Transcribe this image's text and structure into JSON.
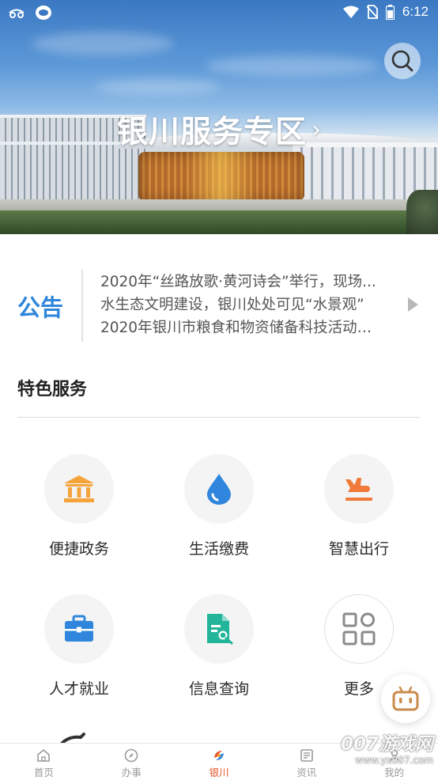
{
  "status_bar": {
    "time": "6:12",
    "left_icons": [
      "incognito-icon",
      "app-bubble-icon"
    ],
    "right_icons": [
      "wifi-icon",
      "no-sim-icon",
      "battery-icon"
    ]
  },
  "hero": {
    "title": "银川服务专区",
    "arrow": "›"
  },
  "notice": {
    "label": "公告",
    "items": [
      "2020年“丝路放歌·黄河诗会”举行，现场...",
      "水生态文明建设，银川处处可见“水景观”",
      "2020年银川市粮食和物资储备科技活动周..."
    ]
  },
  "section": {
    "title": "特色服务"
  },
  "services": [
    {
      "label": "便捷政务",
      "icon": "bank-icon",
      "color": "#f5a33b"
    },
    {
      "label": "生活缴费",
      "icon": "water-drop-icon",
      "color": "#2f86dc"
    },
    {
      "label": "智慧出行",
      "icon": "airplane-icon",
      "color": "#f07a3a"
    },
    {
      "label": "人才就业",
      "icon": "briefcase-icon",
      "color": "#2f86dc"
    },
    {
      "label": "信息查询",
      "icon": "document-search-icon",
      "color": "#23b59a"
    },
    {
      "label": "更多",
      "icon": "grid-icon",
      "color": "#8a8a8a"
    }
  ],
  "bottom_nav": [
    {
      "label": "首页",
      "icon": "home-icon",
      "active": false
    },
    {
      "label": "办事",
      "icon": "compass-icon",
      "active": false
    },
    {
      "label": "银川",
      "icon": "yinchuan-logo-icon",
      "active": true
    },
    {
      "label": "资讯",
      "icon": "news-icon",
      "active": false
    },
    {
      "label": "我的",
      "icon": "profile-icon",
      "active": false
    }
  ],
  "watermark": {
    "main": "007游戏网",
    "url": "www.yx007.com"
  },
  "colors": {
    "accent": "#2f86dc",
    "active_nav": "#e4572e"
  }
}
